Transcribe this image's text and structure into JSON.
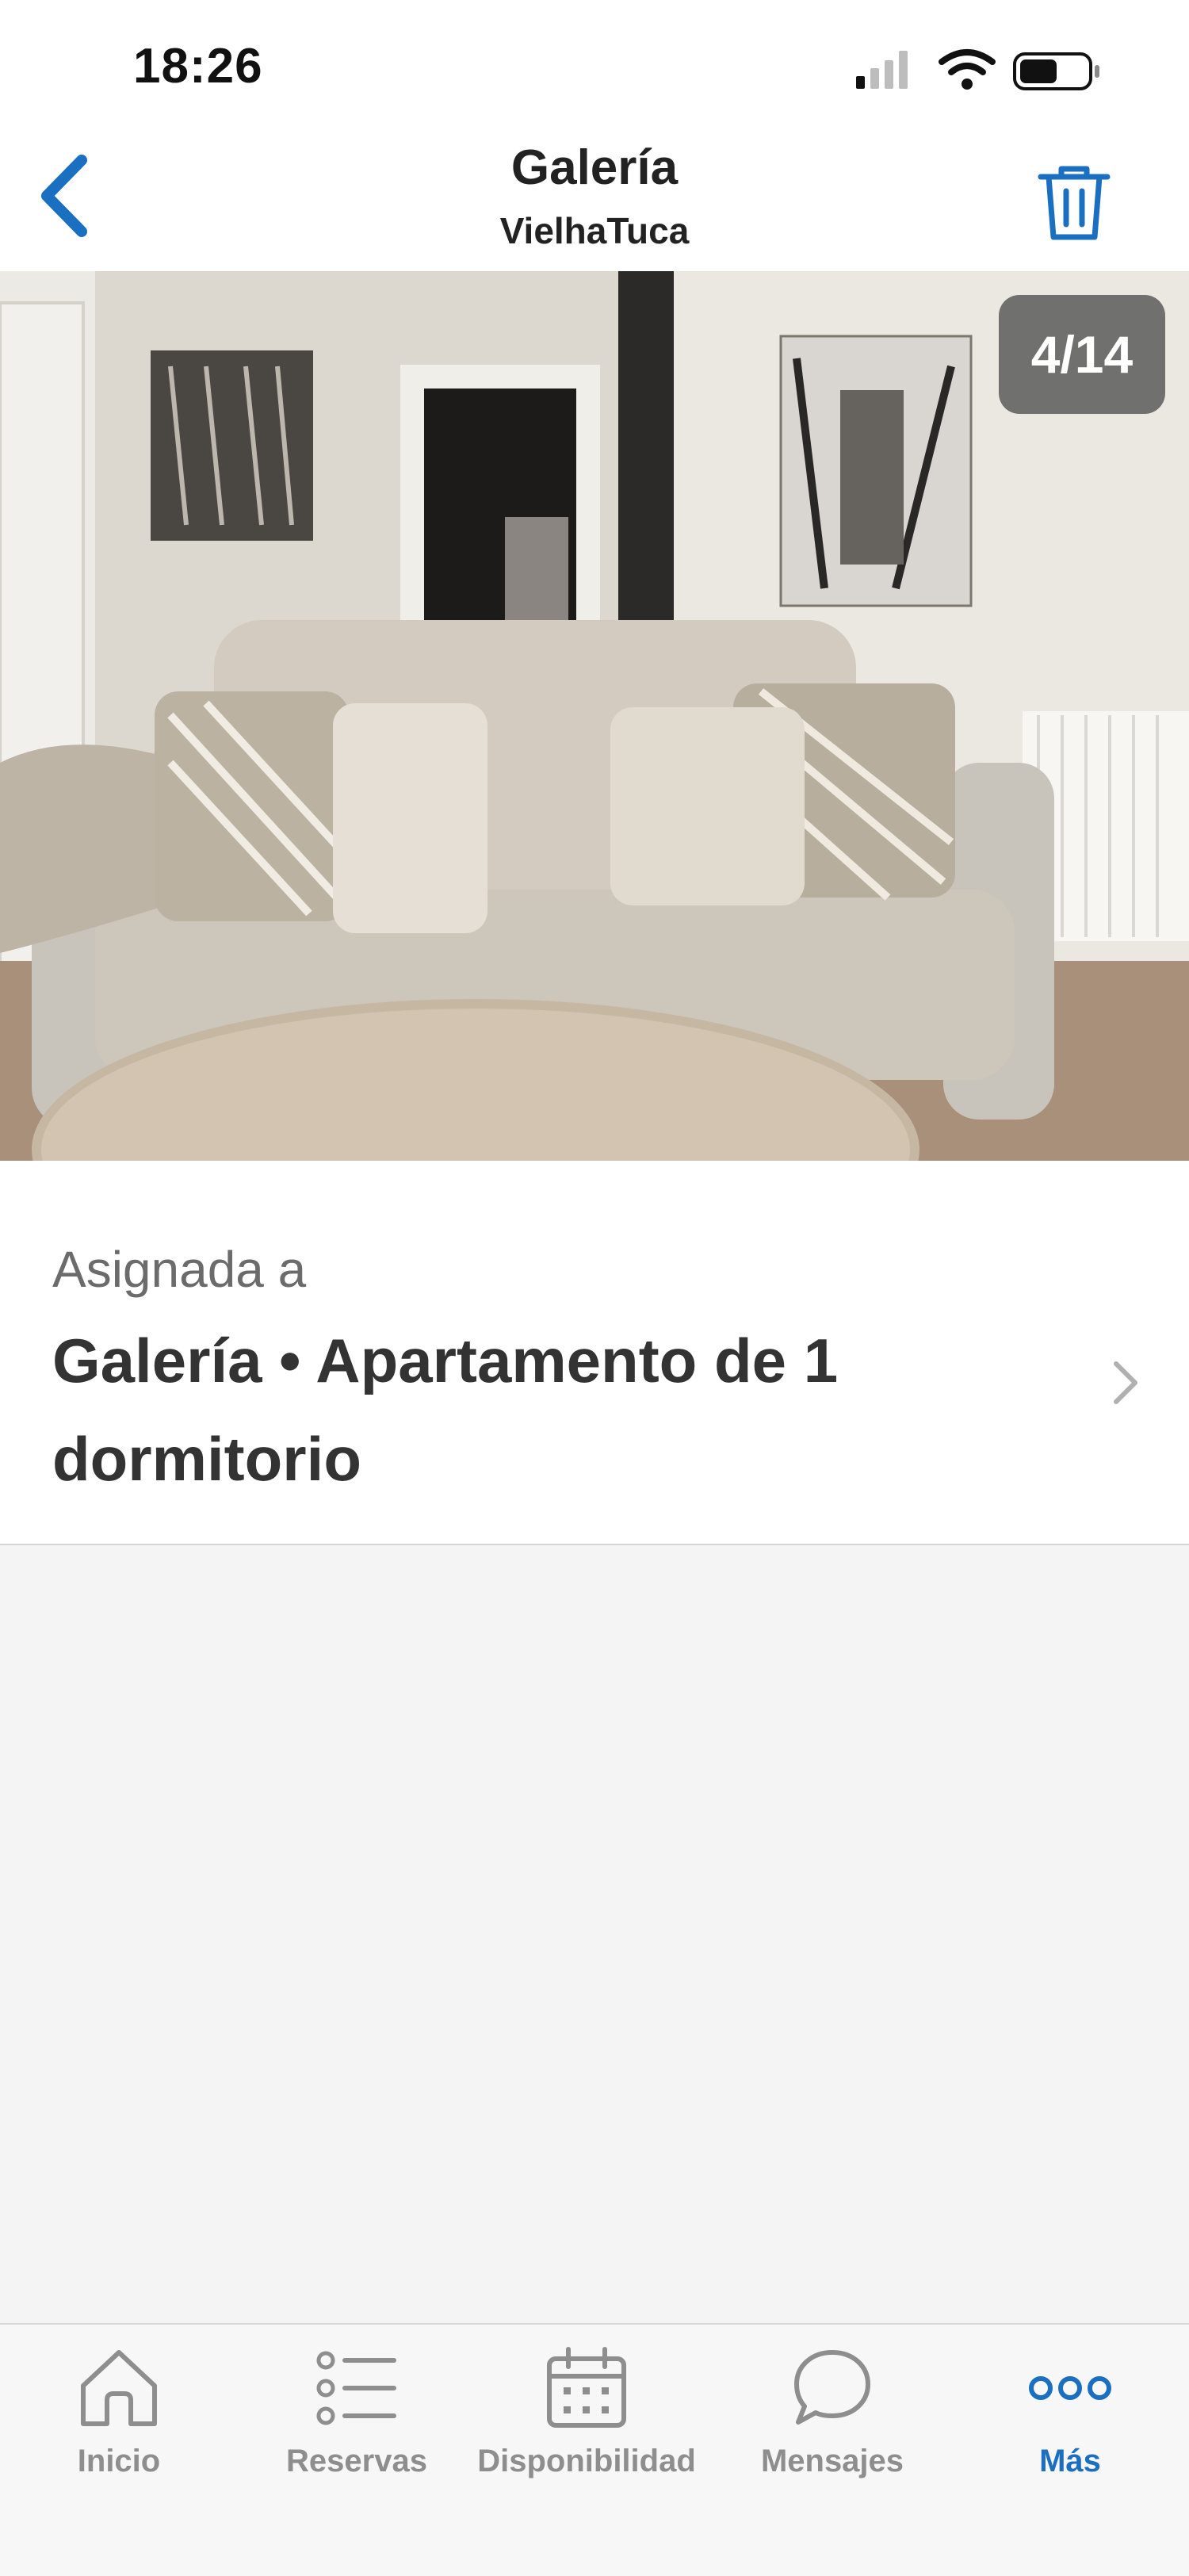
{
  "status_bar": {
    "time": "18:26"
  },
  "nav": {
    "title": "Galería",
    "subtitle": "VielhaTuca"
  },
  "photo": {
    "counter": "4/14"
  },
  "assigned": {
    "label": "Asignada a",
    "value": "Galería • Apartamento de 1 dormitorio"
  },
  "tabs": [
    {
      "label": "Inicio",
      "icon": "home-icon",
      "active": false
    },
    {
      "label": "Reservas",
      "icon": "list-icon",
      "active": false
    },
    {
      "label": "Disponibilidad",
      "icon": "calendar-icon",
      "active": false
    },
    {
      "label": "Mensajes",
      "icon": "chat-bubble-icon",
      "active": false
    },
    {
      "label": "Más",
      "icon": "more-dots-icon",
      "active": true
    }
  ],
  "colors": {
    "accent": "#1a6fc0",
    "inactive": "#8e8e8e",
    "background": "#f4f4f4"
  }
}
